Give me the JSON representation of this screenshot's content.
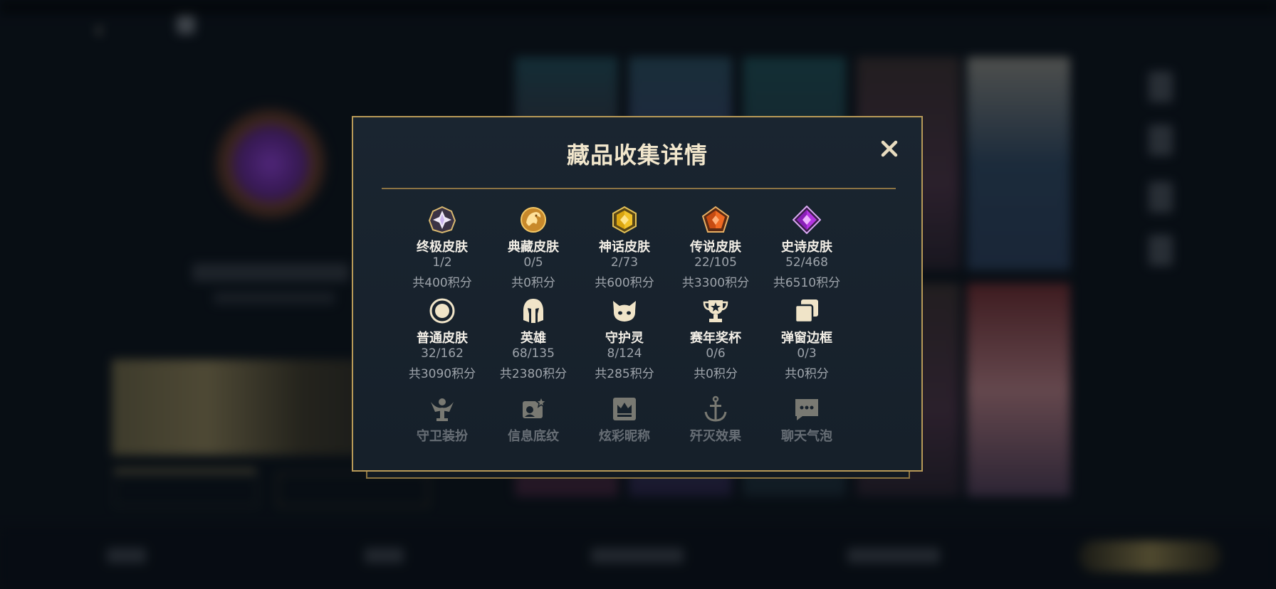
{
  "modal": {
    "title": "藏品收集详情",
    "rows": [
      [
        {
          "label": "终极皮肤",
          "count": "1/2",
          "points": "共400积分",
          "icon": "ultimate-skin-gem-icon"
        },
        {
          "label": "典藏皮肤",
          "count": "0/5",
          "points": "共0积分",
          "icon": "prestige-dragon-icon"
        },
        {
          "label": "神话皮肤",
          "count": "2/73",
          "points": "共600积分",
          "icon": "mythic-hexagon-gem-icon"
        },
        {
          "label": "传说皮肤",
          "count": "22/105",
          "points": "共3300积分",
          "icon": "legendary-pentagon-gem-icon"
        },
        {
          "label": "史诗皮肤",
          "count": "52/468",
          "points": "共6510积分",
          "icon": "epic-diamond-gem-icon"
        }
      ],
      [
        {
          "label": "普通皮肤",
          "count": "32/162",
          "points": "共3090积分",
          "icon": "standard-skin-circle-icon"
        },
        {
          "label": "英雄",
          "count": "68/135",
          "points": "共2380积分",
          "icon": "champion-helmet-icon"
        },
        {
          "label": "守护灵",
          "count": "8/124",
          "points": "共285积分",
          "icon": "companion-cat-icon"
        },
        {
          "label": "赛年奖杯",
          "count": "0/6",
          "points": "共0积分",
          "icon": "season-trophy-icon"
        },
        {
          "label": "弹窗边框",
          "count": "0/3",
          "points": "共0积分",
          "icon": "popup-frame-icon"
        }
      ],
      [
        {
          "label": "守卫装扮",
          "icon": "ward-skin-icon"
        },
        {
          "label": "信息底纹",
          "icon": "banner-pattern-icon"
        },
        {
          "label": "炫彩昵称",
          "icon": "colorful-name-crown-icon"
        },
        {
          "label": "歼灭效果",
          "icon": "finisher-anchor-icon"
        },
        {
          "label": "聊天气泡",
          "icon": "chat-bubble-icon"
        }
      ]
    ]
  },
  "colors": {
    "accent_gold": "#b89a58",
    "modal_bg": "#18232d",
    "title_text": "#f1e6cc",
    "muted_text": "#9ea4ab"
  }
}
